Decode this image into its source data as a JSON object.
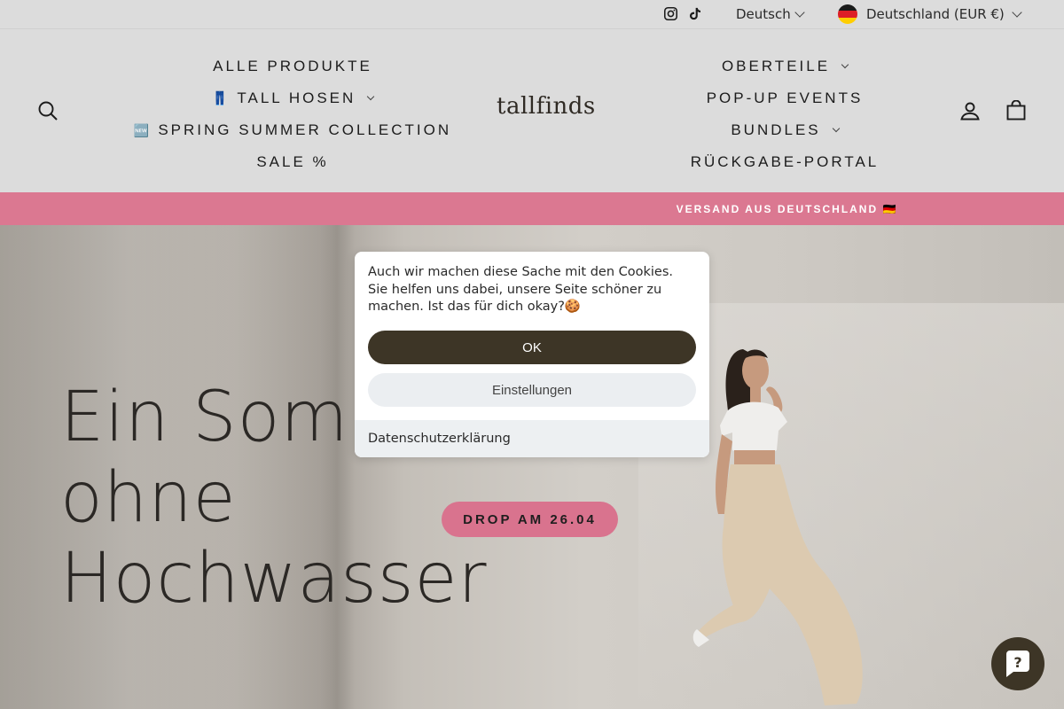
{
  "utility": {
    "social_icons": [
      "instagram-icon",
      "tiktok-icon"
    ],
    "language": "Deutsch",
    "country": "Deutschland (EUR €)"
  },
  "header": {
    "logo": "tallfinds",
    "nav_left": [
      {
        "label": "ALLE PRODUKTE",
        "prefix": "",
        "dropdown": false
      },
      {
        "label": "TALL HOSEN",
        "prefix": "👖",
        "dropdown": true
      },
      {
        "label": "SPRING SUMMER COLLECTION",
        "prefix": "🆕",
        "dropdown": false
      },
      {
        "label": "SALE %",
        "prefix": "",
        "dropdown": false
      }
    ],
    "nav_right": [
      {
        "label": "OBERTEILE",
        "dropdown": true
      },
      {
        "label": "POP-UP EVENTS",
        "dropdown": false
      },
      {
        "label": "BUNDLES",
        "dropdown": true
      },
      {
        "label": "RÜCKGABE-PORTAL",
        "dropdown": false
      }
    ],
    "icons": [
      "search-icon",
      "account-icon",
      "cart-icon"
    ]
  },
  "announcement": {
    "text": "VERSAND AUS DEUTSCHLAND 🇩🇪"
  },
  "hero": {
    "title_lines": [
      "Ein Somm",
      "ohne",
      "Hochwasser"
    ],
    "cta": "DROP AM 26.04"
  },
  "cookie_banner": {
    "text": "Auch wir machen diese Sache mit den Cookies. Sie helfen uns dabei, unsere Seite schöner zu machen. Ist das für dich okay?🍪",
    "ok_label": "OK",
    "settings_label": "Einstellungen",
    "privacy_link": "Datenschutzerklärung"
  },
  "colors": {
    "accent_pink": "#db7891",
    "dark_brown": "#3d3526",
    "header_bg": "#dcdcdc"
  }
}
